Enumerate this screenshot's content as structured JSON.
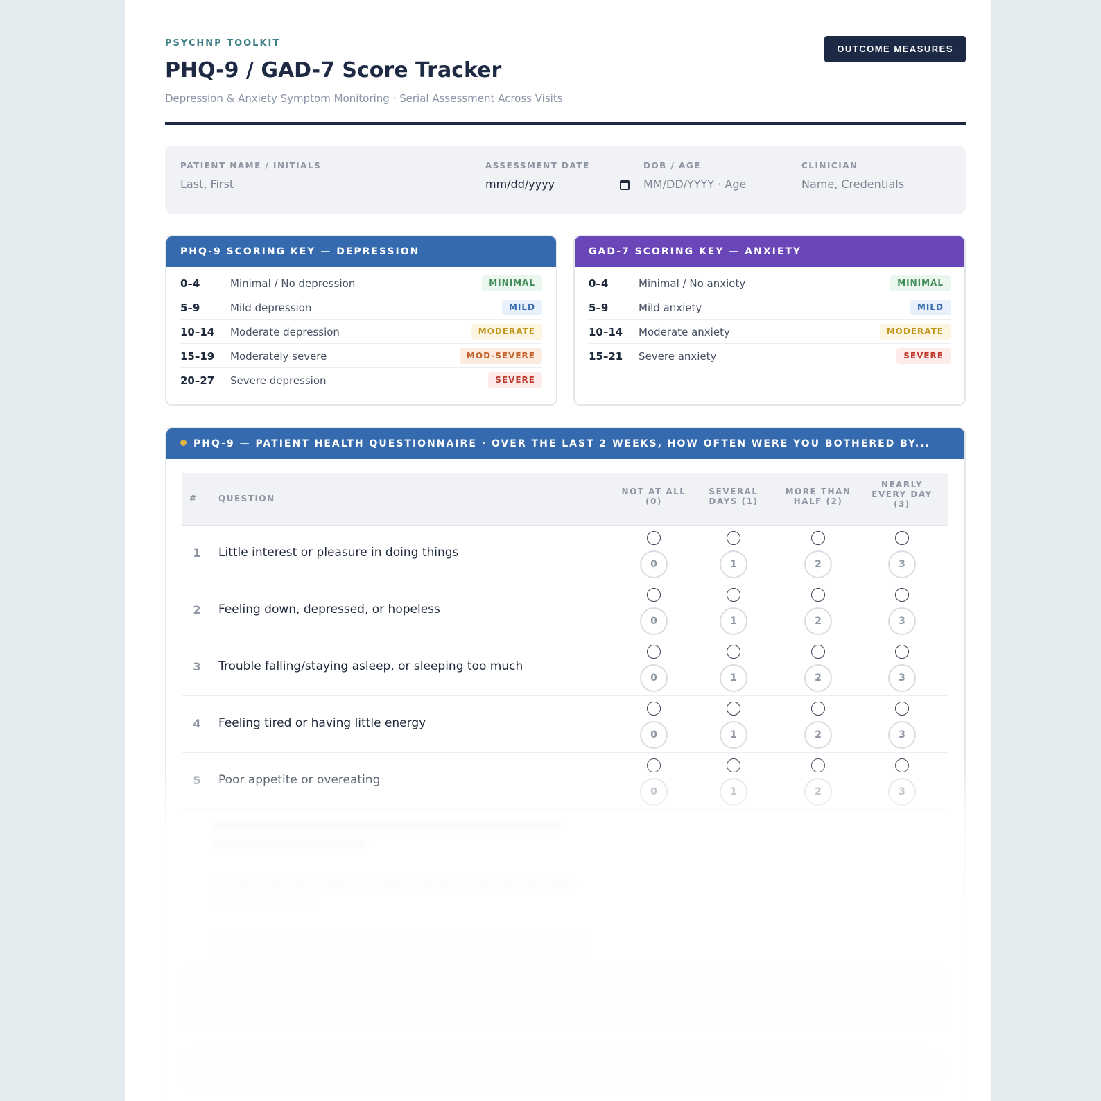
{
  "header": {
    "eyebrow": "PSYCHNP TOOLKIT",
    "title": "PHQ-9 / GAD-7 Score Tracker",
    "subtitle": "Depression & Anxiety Symptom Monitoring · Serial Assessment Across Visits",
    "badge": "OUTCOME MEASURES"
  },
  "patient": {
    "name_label": "PATIENT NAME / INITIALS",
    "name_placeholder": "Last, First",
    "date_label": "ASSESSMENT DATE",
    "date_value": "mm/dd/yyyy",
    "dob_label": "DOB / AGE",
    "dob_placeholder": "MM/DD/YYYY · Age",
    "clinician_label": "CLINICIAN",
    "clinician_placeholder": "Name, Credentials"
  },
  "phq_key": {
    "title": "PHQ-9 SCORING KEY — DEPRESSION",
    "rows": [
      {
        "range": "0–4",
        "desc": "Minimal / No depression",
        "tag": "MINIMAL"
      },
      {
        "range": "5–9",
        "desc": "Mild depression",
        "tag": "MILD"
      },
      {
        "range": "10–14",
        "desc": "Moderate depression",
        "tag": "MODERATE"
      },
      {
        "range": "15–19",
        "desc": "Moderately severe",
        "tag": "MOD-SEVERE"
      },
      {
        "range": "20–27",
        "desc": "Severe depression",
        "tag": "SEVERE"
      }
    ]
  },
  "gad_key": {
    "title": "GAD-7 SCORING KEY — ANXIETY",
    "rows": [
      {
        "range": "0–4",
        "desc": "Minimal / No anxiety",
        "tag": "MINIMAL"
      },
      {
        "range": "5–9",
        "desc": "Mild anxiety",
        "tag": "MILD"
      },
      {
        "range": "10–14",
        "desc": "Moderate anxiety",
        "tag": "MODERATE"
      },
      {
        "range": "15–21",
        "desc": "Severe anxiety",
        "tag": "SEVERE"
      }
    ]
  },
  "phq_questionnaire": {
    "title": "PHQ-9 — PATIENT HEALTH QUESTIONNAIRE · OVER THE LAST 2 WEEKS, HOW OFTEN WERE YOU BOTHERED BY...",
    "columns": {
      "num": "#",
      "question": "QUESTION",
      "c0": "NOT AT ALL (0)",
      "c1": "SEVERAL DAYS (1)",
      "c2": "MORE THAN HALF (2)",
      "c3": "NEARLY EVERY DAY (3)"
    },
    "score_options": [
      "0",
      "1",
      "2",
      "3"
    ],
    "questions": [
      {
        "num": "1",
        "text": "Little interest or pleasure in doing things"
      },
      {
        "num": "2",
        "text": "Feeling down, depressed, or hopeless"
      },
      {
        "num": "3",
        "text": "Trouble falling/staying asleep, or sleeping too much"
      },
      {
        "num": "4",
        "text": "Feeling tired or having little energy"
      },
      {
        "num": "5",
        "text": "Poor appetite or overeating"
      }
    ]
  }
}
